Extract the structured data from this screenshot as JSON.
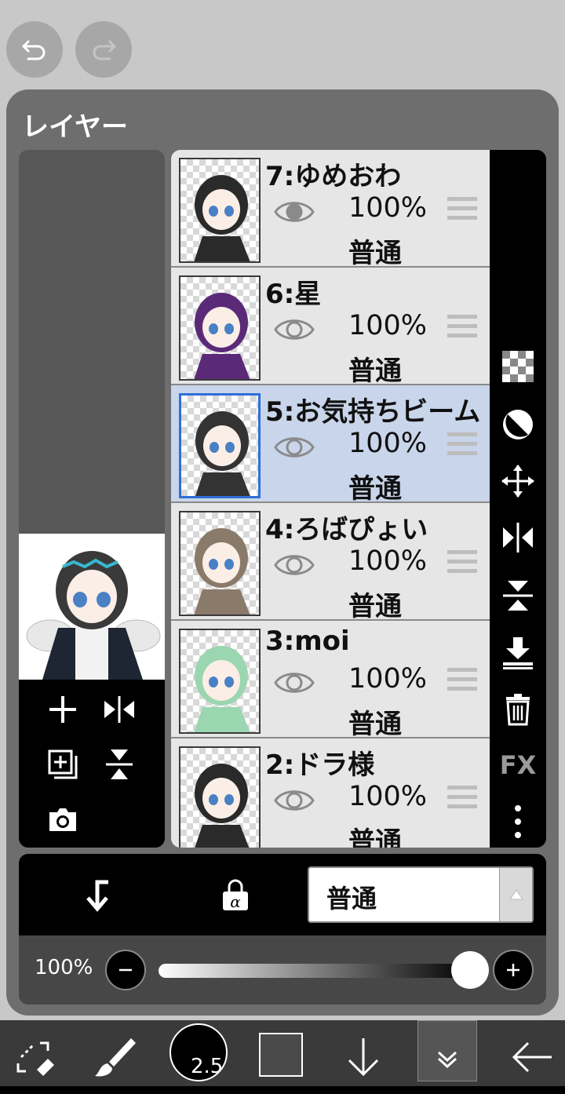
{
  "toolbar_top": {
    "undo_icon": "undo-icon",
    "redo_icon": "redo-icon"
  },
  "panel": {
    "title": "レイヤー"
  },
  "layers": [
    {
      "name": "7:ゆめおわ",
      "opacity": "100%",
      "blend": "普通",
      "visible": true,
      "selected": false,
      "thumb_color": "#2a2a2a"
    },
    {
      "name": "6:星",
      "opacity": "100%",
      "blend": "普通",
      "visible": false,
      "selected": false,
      "thumb_color": "#5a2a78"
    },
    {
      "name": "5:お気持ちビーム",
      "opacity": "100%",
      "blend": "普通",
      "visible": false,
      "selected": true,
      "thumb_color": "#333333"
    },
    {
      "name": "4:ろばぴょい",
      "opacity": "100%",
      "blend": "普通",
      "visible": false,
      "selected": false,
      "thumb_color": "#8a7a6a"
    },
    {
      "name": "3:moi",
      "opacity": "100%",
      "blend": "普通",
      "visible": false,
      "selected": false,
      "thumb_color": "#9ad6b0"
    },
    {
      "name": "2:ドラ様",
      "opacity": "100%",
      "blend": "普通",
      "visible": false,
      "selected": false,
      "thumb_color": "#2a2a2a"
    }
  ],
  "blend_mode": {
    "selected": "普通"
  },
  "opacity_slider": {
    "label": "100%",
    "value": 1.0
  },
  "bottom_toolbar": {
    "brush_size": "2.5"
  },
  "colors": {
    "selected_layer_bg": "#c9d5ea",
    "selected_border": "#2e6fd8",
    "panel_bg": "#6e6e6e"
  }
}
